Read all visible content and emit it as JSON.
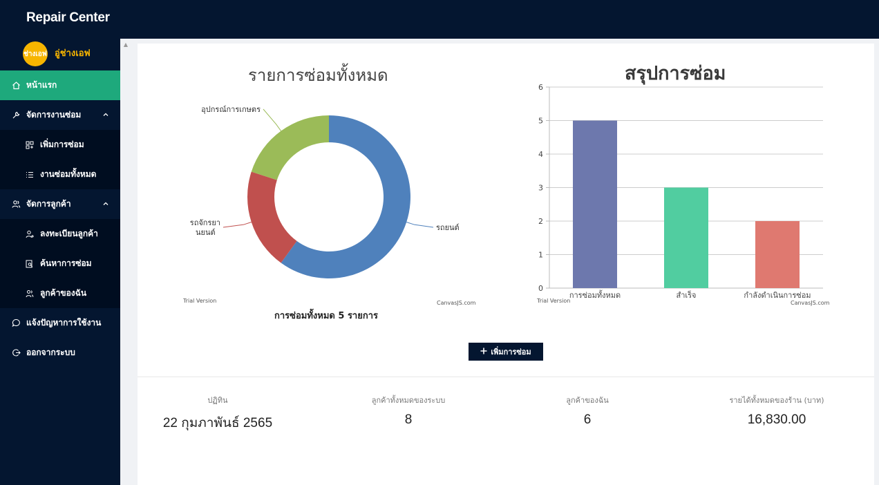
{
  "app": {
    "title": "Repair Center"
  },
  "user": {
    "avatar_text": "ช่างเอฟ",
    "name": "อู่ช่างเอฟ"
  },
  "sidebar": {
    "items": [
      {
        "label": "หน้าแรก",
        "icon": "home-icon",
        "active": true
      },
      {
        "label": "จัดการงานซ่อม",
        "icon": "wrench-icon",
        "expanded": true
      },
      {
        "label": "เพิ่มการซ่อม",
        "icon": "add-grid-icon",
        "sub": true
      },
      {
        "label": "งานซ่อมทั้งหมด",
        "icon": "list-icon",
        "sub": true
      },
      {
        "label": "จัดการลูกค้า",
        "icon": "users-icon",
        "expanded": true
      },
      {
        "label": "ลงทะเบียนลูกค้า",
        "icon": "user-add-icon",
        "sub": true
      },
      {
        "label": "ค้นหาการซ่อม",
        "icon": "search-doc-icon",
        "sub": true
      },
      {
        "label": "ลูกค้าของฉัน",
        "icon": "users-icon",
        "sub": true
      },
      {
        "label": "แจ้งปัญหาการใช้งาน",
        "icon": "chat-icon"
      },
      {
        "label": "ออกจากระบบ",
        "icon": "logout-icon"
      }
    ]
  },
  "donut": {
    "title": "รายการซ่อมทั้งหมด",
    "caption": "การซ่อมทั้งหมด 5 รายการ",
    "trial": "Trial Version",
    "credit": "CanvasJS.com"
  },
  "bar": {
    "title": "สรุปการซ่อม",
    "trial": "Trial Version",
    "credit": "CanvasJS.com"
  },
  "chart_data": [
    {
      "type": "pie",
      "title": "รายการซ่อมทั้งหมด",
      "categories": [
        "รถยนต์",
        "รถจักรยานยนต์",
        "อุปกรณ์การเกษตร"
      ],
      "values": [
        3,
        1,
        1
      ],
      "colors": [
        "#4f81bc",
        "#c0504e",
        "#9bbb58"
      ]
    },
    {
      "type": "bar",
      "title": "สรุปการซ่อม",
      "categories": [
        "การซ่อมทั้งหมด",
        "สำเร็จ",
        "กำลังดำเนินการซ่อม"
      ],
      "values": [
        5,
        3,
        2
      ],
      "colors": [
        "#6d78ad",
        "#51cda0",
        "#df7970"
      ],
      "ylim": [
        0,
        6
      ],
      "yticks": [
        0,
        1,
        2,
        3,
        4,
        5,
        6
      ],
      "grid": true
    }
  ],
  "actions": {
    "add_repair": "เพิ่มการซ่อม"
  },
  "stats": [
    {
      "label": "ปฏิทิน",
      "value": "22 กุมภาพันธ์ 2565"
    },
    {
      "label": "ลูกค้าทั้งหมดของระบบ",
      "value": "8"
    },
    {
      "label": "ลูกค้าของฉัน",
      "value": "6"
    },
    {
      "label": "รายได้ทั้งหมดของร้าน (บาท)",
      "value": "16,830.00"
    }
  ]
}
